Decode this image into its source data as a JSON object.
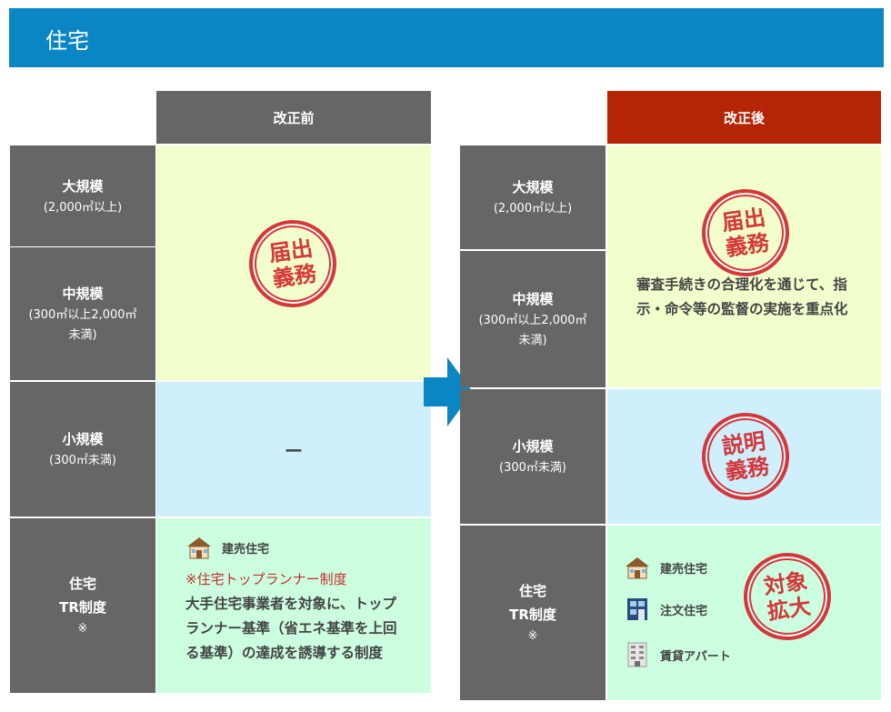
{
  "page": {
    "title": "住宅"
  },
  "before": {
    "header": "改正前",
    "rows": [
      {
        "name": "大規模",
        "sub": "(2,000㎡以上)"
      },
      {
        "name": "中規模",
        "sub": "(300㎡以上2,000㎡未満)"
      },
      {
        "name": "小規模",
        "sub": "(300㎡未満)"
      },
      {
        "name": "住宅",
        "name2": "TR制度",
        "note": "※"
      }
    ],
    "stamp_notify": [
      "届出",
      "義務"
    ],
    "small_value": "ー",
    "tr": {
      "house": "建売住宅",
      "program": "※住宅トップランナー制度",
      "description": "大手住宅事業者を対象に、トップランナー基準（省エネ基準を上回る基準）の達成を誘導する制度"
    }
  },
  "after": {
    "header": "改正後",
    "rows": [
      {
        "name": "大規模",
        "sub": "(2,000㎡以上)"
      },
      {
        "name": "中規模",
        "sub": "(300㎡以上2,000㎡未満)"
      },
      {
        "name": "小規模",
        "sub": "(300㎡未満)"
      },
      {
        "name": "住宅",
        "name2": "TR制度",
        "note": "※"
      }
    ],
    "stamp_notify": [
      "届出",
      "義務"
    ],
    "mid_description": "審査手続きの合理化を通じて、指示・命令等の監督の実施を重点化",
    "stamp_explain": [
      "説明",
      "義務"
    ],
    "tr": {
      "items": [
        "建売住宅",
        "注文住宅",
        "賃貸アパート"
      ],
      "stamp_expand": [
        "対象",
        "拡大"
      ]
    }
  },
  "colors": {
    "title_bar": "#0b86c5",
    "header_before": "#666666",
    "header_after": "#b52505",
    "row_label": "#666666",
    "stamp": "#d3282c",
    "yellow": "#f2ffcc",
    "blue": "#cfeffd",
    "green": "#ccffe0",
    "arrow": "#0b86c5"
  },
  "icons": [
    "house-icon",
    "townhouse-icon",
    "apartment-icon",
    "arrow-right-icon"
  ]
}
